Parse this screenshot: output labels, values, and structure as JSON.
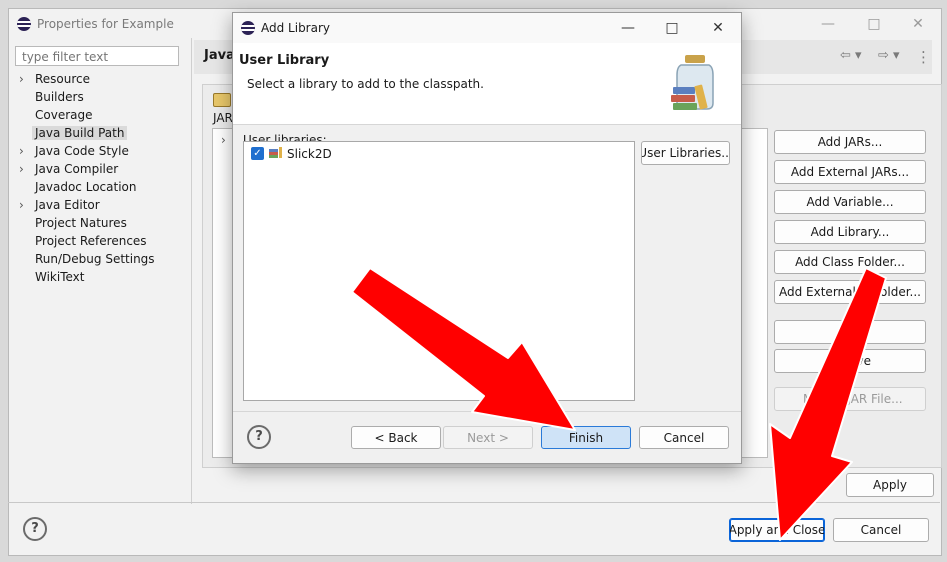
{
  "main_window": {
    "title": "Properties for Example",
    "filter_placeholder": "type filter text",
    "tree": [
      {
        "label": "Resource",
        "expandable": true,
        "selected": false
      },
      {
        "label": "Builders",
        "expandable": false,
        "selected": false
      },
      {
        "label": "Coverage",
        "expandable": false,
        "selected": false
      },
      {
        "label": "Java Build Path",
        "expandable": false,
        "selected": true
      },
      {
        "label": "Java Code Style",
        "expandable": true,
        "selected": false
      },
      {
        "label": "Java Compiler",
        "expandable": true,
        "selected": false
      },
      {
        "label": "Javadoc Location",
        "expandable": false,
        "selected": false
      },
      {
        "label": "Java Editor",
        "expandable": true,
        "selected": false
      },
      {
        "label": "Project Natures",
        "expandable": false,
        "selected": false
      },
      {
        "label": "Project References",
        "expandable": false,
        "selected": false
      },
      {
        "label": "Run/Debug Settings",
        "expandable": false,
        "selected": false
      },
      {
        "label": "WikiText",
        "expandable": false,
        "selected": false
      }
    ],
    "page_title_partial": "Java",
    "jar_label_partial": "JAR",
    "side_buttons": {
      "add_jars": "Add JARs...",
      "add_external_jars": "Add External JARs...",
      "add_variable": "Add Variable...",
      "add_library": "Add Library...",
      "add_class_folder": "Add Class Folder...",
      "add_external_class_folder_left": "Add External",
      "add_external_class_folder_right": "Folder...",
      "remove_partial": "ove",
      "migrate_jar_left": "M",
      "migrate_jar_right": "JAR File..."
    },
    "apply_label": "Apply",
    "apply_close_label": "Apply and Close",
    "cancel_label": "Cancel"
  },
  "dialog": {
    "title": "Add Library",
    "header_title": "User Library",
    "header_desc": "Select a library to add to the classpath.",
    "section_label": "User libraries:",
    "libraries": [
      {
        "label": "Slick2D",
        "checked": true
      }
    ],
    "user_libraries_button": "User Libraries...",
    "back_label": "< Back",
    "next_label": "Next >",
    "finish_label": "Finish",
    "cancel_label": "Cancel"
  },
  "colors": {
    "accent": "#0a64d8",
    "arrow": "#ff0000",
    "checkbox": "#1f6fcf"
  }
}
